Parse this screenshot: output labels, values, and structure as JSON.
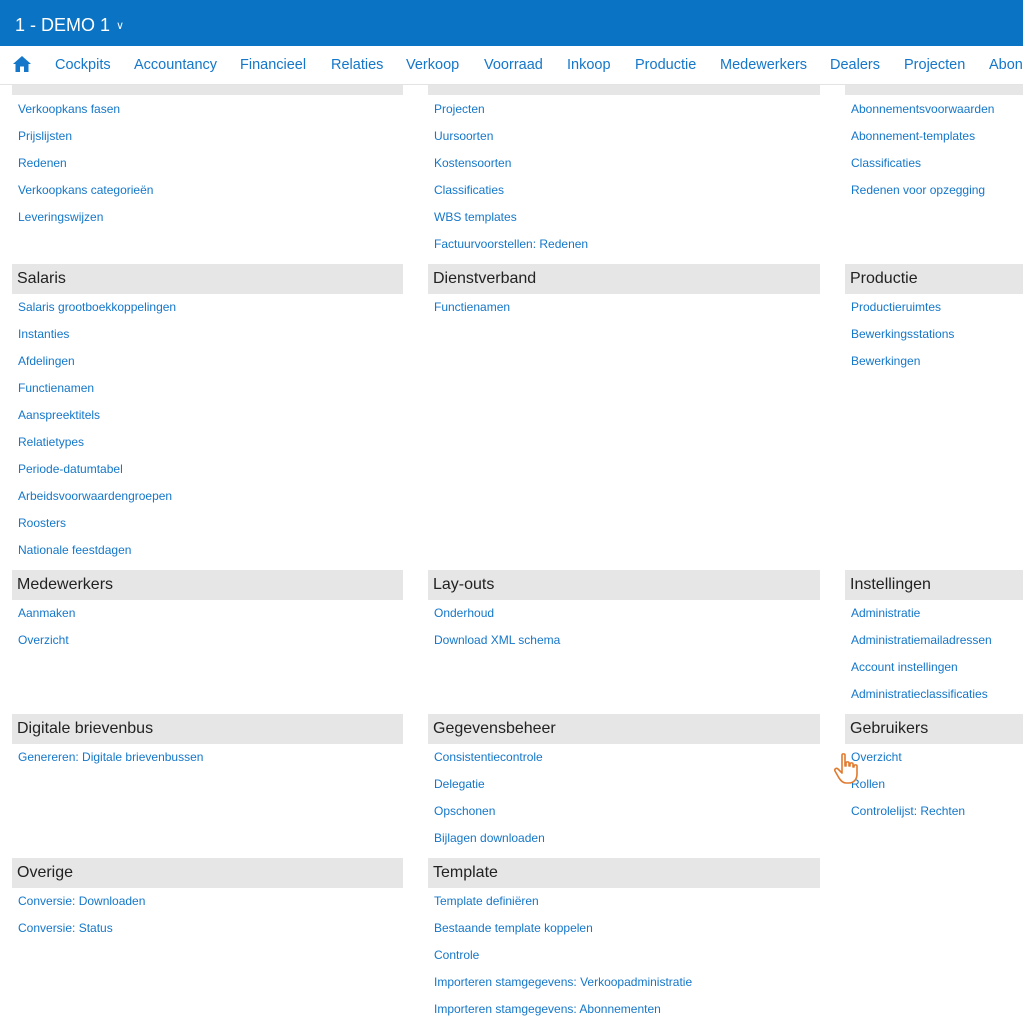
{
  "header": {
    "title": "1 - DEMO 1",
    "accent_color": "#0a73c4"
  },
  "nav": {
    "home_icon": "home-icon",
    "items": [
      "Cockpits",
      "Accountancy",
      "Financieel",
      "Relaties",
      "Verkoop",
      "Voorraad",
      "Inkoop",
      "Productie",
      "Medewerkers",
      "Dealers",
      "Projecten",
      "Abon"
    ]
  },
  "col1": {
    "sec0": {
      "links": [
        "Verkoopkans fasen",
        "Prijslijsten",
        "Redenen",
        "Verkoopkans categorieën",
        "Leveringswijzen"
      ]
    },
    "sec1": {
      "title": "Salaris",
      "links": [
        "Salaris grootboekkoppelingen",
        "Instanties",
        "Afdelingen",
        "Functienamen",
        "Aanspreektitels",
        "Relatietypes",
        "Periode-datumtabel",
        "Arbeidsvoorwaardengroepen",
        "Roosters",
        "Nationale feestdagen"
      ]
    },
    "sec2": {
      "title": "Medewerkers",
      "links": [
        "Aanmaken",
        "Overzicht"
      ]
    },
    "sec3": {
      "title": "Digitale brievenbus",
      "links": [
        "Genereren: Digitale brievenbussen"
      ]
    },
    "sec4": {
      "title": "Overige",
      "links": [
        "Conversie: Downloaden",
        "Conversie: Status"
      ]
    }
  },
  "col2": {
    "sec0": {
      "links": [
        "Projecten",
        "Uursoorten",
        "Kostensoorten",
        "Classificaties",
        "WBS templates",
        "Factuurvoorstellen: Redenen"
      ]
    },
    "sec1": {
      "title": "Dienstverband",
      "links": [
        "Functienamen"
      ]
    },
    "sec2": {
      "title": "Lay-outs",
      "links": [
        "Onderhoud",
        "Download XML schema"
      ]
    },
    "sec3": {
      "title": "Gegevensbeheer",
      "links": [
        "Consistentiecontrole",
        "Delegatie",
        "Opschonen",
        "Bijlagen downloaden"
      ]
    },
    "sec4": {
      "title": "Template",
      "links": [
        "Template definiëren",
        "Bestaande template koppelen",
        "Controle",
        "Importeren stamgegevens: Verkoopadministratie",
        "Importeren stamgegevens: Abonnementen"
      ]
    }
  },
  "col3": {
    "sec0": {
      "links": [
        "Abonnementsvoorwaarden",
        "Abonnement-templates",
        "Classificaties",
        "Redenen voor opzegging"
      ]
    },
    "sec1": {
      "title": "Productie",
      "links": [
        "Productieruimtes",
        "Bewerkingsstations",
        "Bewerkingen"
      ]
    },
    "sec2": {
      "title": "Instellingen",
      "links": [
        "Administratie",
        "Administratiemailadressen",
        "Account instellingen",
        "Administratieclassificaties"
      ]
    },
    "sec3": {
      "title": "Gebruikers",
      "links": [
        "Overzicht",
        "Rollen",
        "Controlelijst: Rechten"
      ]
    }
  }
}
